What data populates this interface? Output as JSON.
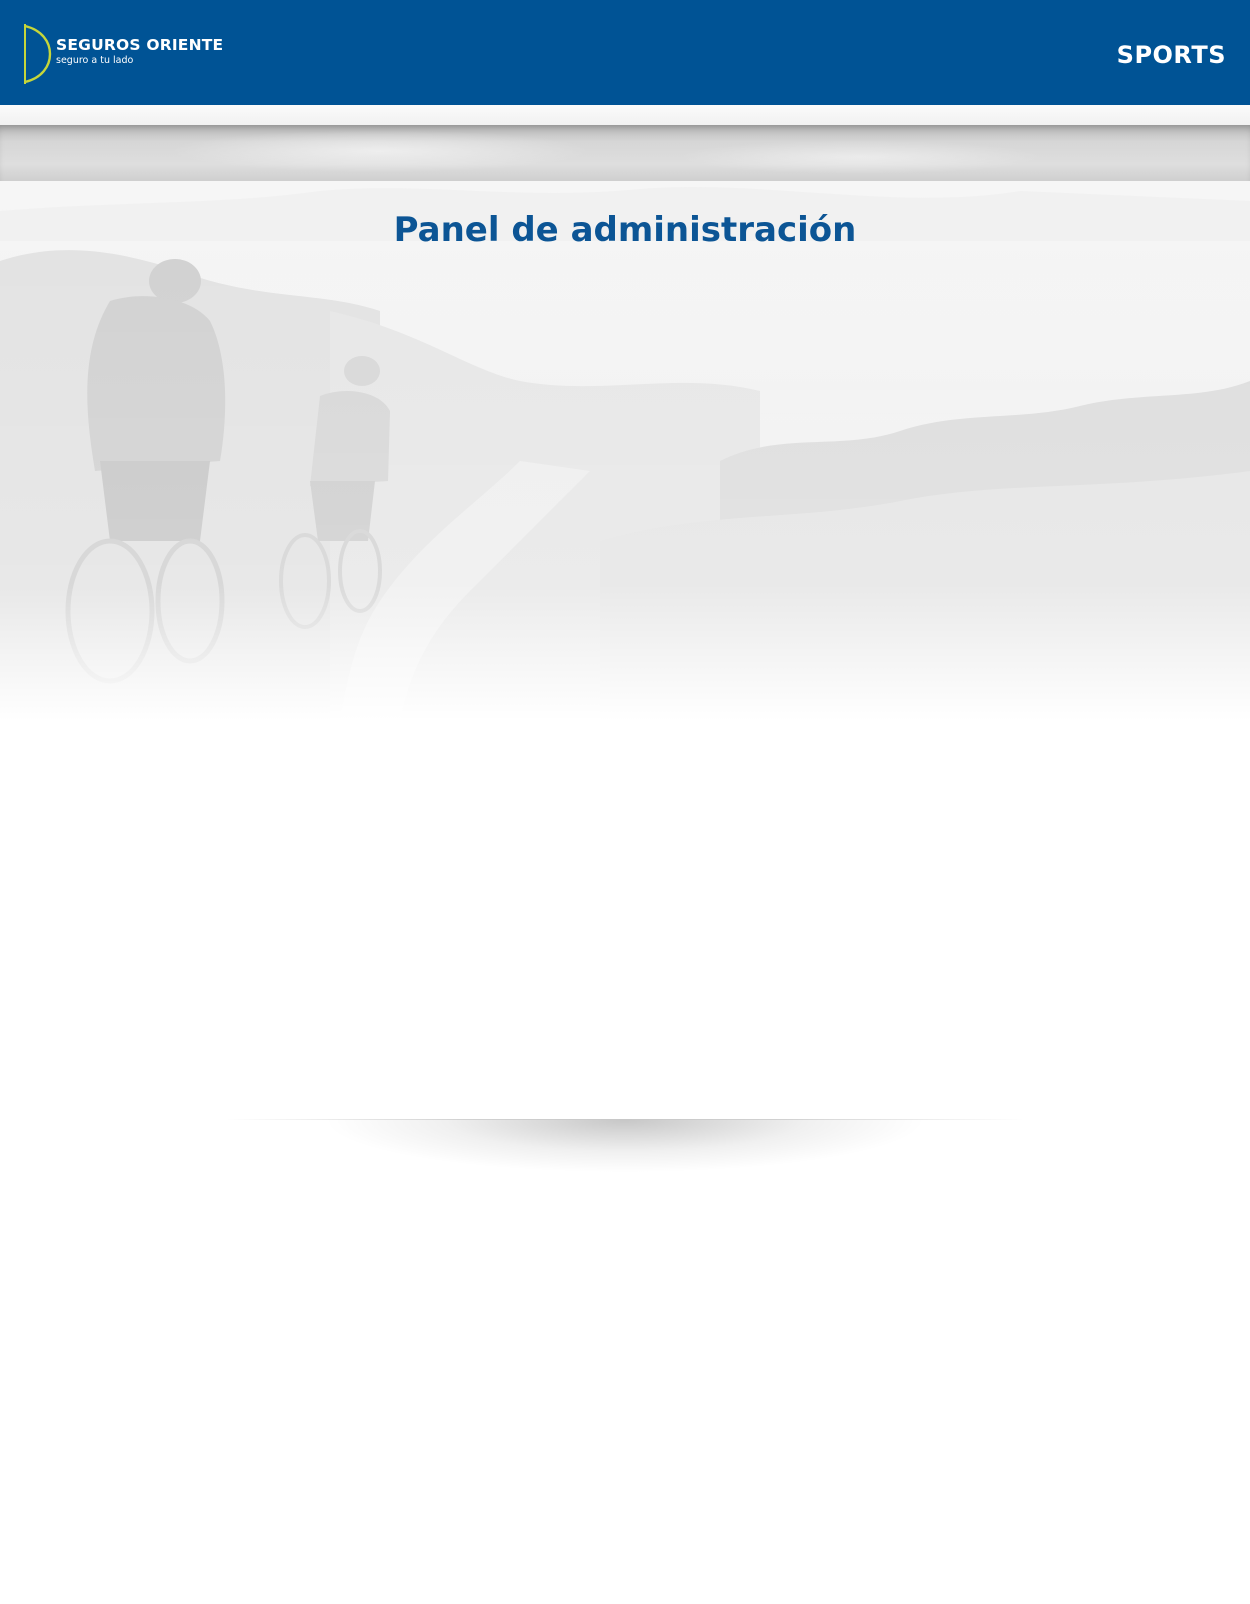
{
  "brand": {
    "name": "SEGUROS ORIENTE",
    "tagline": "seguro a tu lado",
    "logo_icon": "seguros-oriente-logo-icon",
    "primary_color": "#005395",
    "accent_color": "#c6d63a"
  },
  "header": {
    "section_label": "SPORTS"
  },
  "main": {
    "title": "Panel de administración",
    "title_color": "#0c5595",
    "background_image": "faded-cyclists-landscape"
  }
}
